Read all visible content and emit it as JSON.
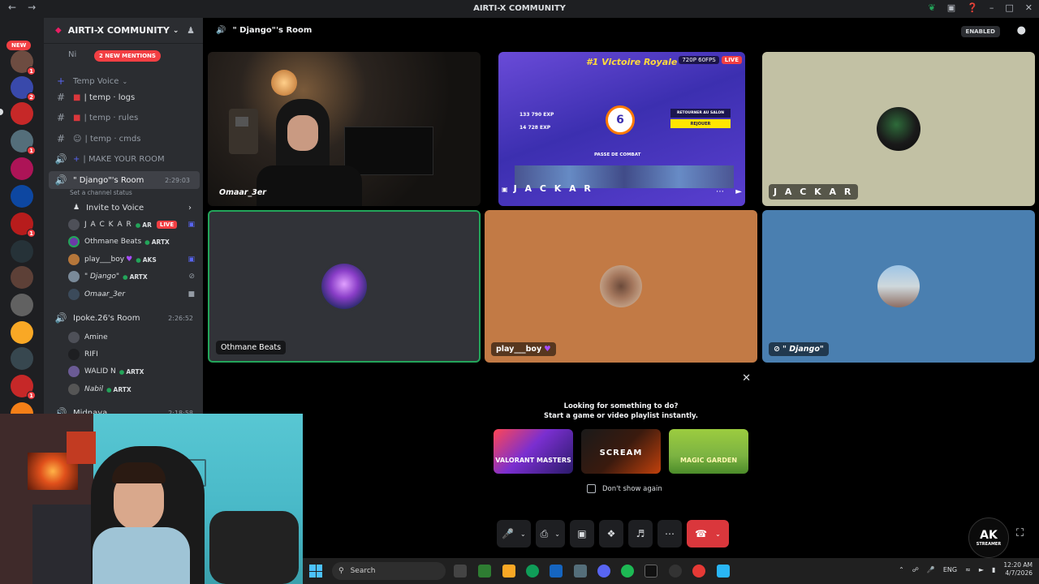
{
  "window": {
    "title": "AIRTI-X COMMUNITY"
  },
  "rail": {
    "new_label": "NEW"
  },
  "server": {
    "name": "AIRTI-X COMMUNITY",
    "mentions_badge": "2 NEW MENTIONS",
    "partial_row": "Ni"
  },
  "channels": {
    "temp_voice": "Temp Voice",
    "temp_logs": "| temp · logs",
    "temp_rules": "| temp · rules",
    "temp_cmds": "| temp · cmds",
    "make_room": "| MAKE YOUR ROOM",
    "django_room": "\" Django\"'s Room",
    "django_time": "2:29:03",
    "set_status": "Set a channel status",
    "invite": "Invite to Voice",
    "ipoke_room": "Ipoke.26's Room",
    "ipoke_time": "2:26:52",
    "cut_room": "Midnaya",
    "cut_time": "2:18:58"
  },
  "members": [
    {
      "name": "J A C K A R",
      "tag": "AR",
      "live": "LIVE"
    },
    {
      "name": "Othmane Beats",
      "tag": "ARTX"
    },
    {
      "name": "play___boy",
      "tag": "AKS"
    },
    {
      "name": "\" Django\"",
      "tag": "ARTX"
    },
    {
      "name": "Omaar_3er"
    }
  ],
  "members2": [
    {
      "name": "Amine"
    },
    {
      "name": "RIFI"
    },
    {
      "name": "WALID N",
      "tag": "ARTX"
    },
    {
      "name": "Nabil",
      "tag": "ARTX"
    }
  ],
  "callbar": {
    "room": "\" Django\"'s Room",
    "enabled": "ENABLED"
  },
  "tiles": {
    "omaar": "Omaar_3er",
    "jackar_stream": "J A C K A R",
    "stream_quality": "720P 60FPS",
    "stream_live": "LIVE",
    "game_title": "#1 Victoire Royale",
    "game_level": "6",
    "game_exp1": "133 790 EXP",
    "game_exp2": "14 728 EXP",
    "game_btn1": "RETOURNER AU SALON",
    "game_btn2": "REJOUER",
    "game_pass": "PASSE DE COMBAT",
    "jackar": "J A C K A R",
    "othmane": "Othmane Beats",
    "playboy": "play___boy",
    "django": "\" Django\""
  },
  "popup": {
    "line1": "Looking for something to do?",
    "line2": "Start a game or video playlist instantly.",
    "activities": [
      "VALORANT MASTERS",
      "SCREAM",
      "MAGIC GARDEN"
    ],
    "dont_show": "Don't show again"
  },
  "logo": {
    "big": "AK",
    "small": "STREAMER"
  },
  "taskbar": {
    "search": "Search",
    "lang": "ENG",
    "time": "12:20 AM",
    "date": "4/7/2026"
  },
  "colors": {
    "accent": "#5865f2",
    "live": "#f23f43",
    "online": "#23a55a",
    "end_call": "#da373c"
  }
}
